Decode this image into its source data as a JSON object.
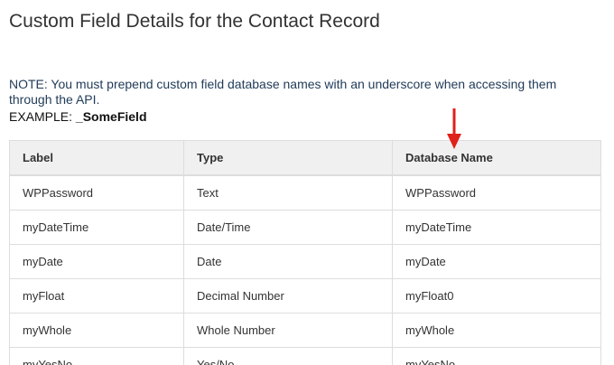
{
  "page": {
    "title": "Custom Field Details for the Contact Record",
    "note": "NOTE: You must prepend custom field database names with an underscore when accessing them through the API.",
    "example_label": "EXAMPLE: ",
    "example_value": "_SomeField"
  },
  "table": {
    "headers": [
      "Label",
      "Type",
      "Database Name"
    ],
    "rows": [
      {
        "label": "WPPassword",
        "type": "Text",
        "db": "WPPassword"
      },
      {
        "label": "myDateTime",
        "type": "Date/Time",
        "db": "myDateTime"
      },
      {
        "label": "myDate",
        "type": "Date",
        "db": "myDate"
      },
      {
        "label": "myFloat",
        "type": "Decimal Number",
        "db": "myFloat0"
      },
      {
        "label": "myWhole",
        "type": "Whole Number",
        "db": "myWhole"
      },
      {
        "label": "myYesNo",
        "type": "Yes/No",
        "db": "myYesNo"
      }
    ]
  },
  "colors": {
    "arrow": "#e0201b",
    "header_bg": "#f0f0f0",
    "border": "#dddddd",
    "note_text": "#1f3a57"
  },
  "icons": {
    "annotation": "down-arrow-icon"
  }
}
